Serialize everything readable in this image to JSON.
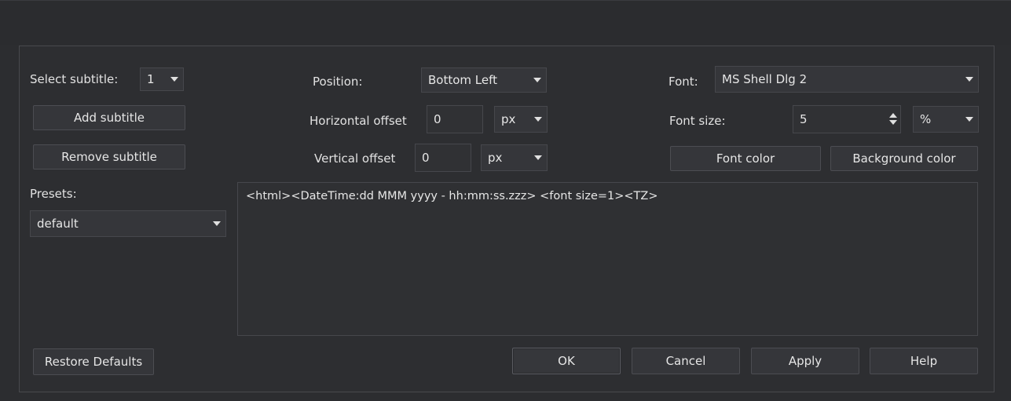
{
  "subtitle": {
    "select_label": "Select subtitle:",
    "selected": "1",
    "add_label": "Add subtitle",
    "remove_label": "Remove subtitle"
  },
  "presets": {
    "label": "Presets:",
    "selected": "default"
  },
  "position": {
    "position_label": "Position:",
    "position_value": "Bottom Left",
    "horizontal_label": "Horizontal offset",
    "horizontal_value": "0",
    "horizontal_unit": "px",
    "vertical_label": "Vertical offset",
    "vertical_value": "0",
    "vertical_unit": "px"
  },
  "font": {
    "font_label": "Font:",
    "font_value": "MS Shell Dlg 2",
    "size_label": "Font size:",
    "size_value": "5",
    "size_unit": "%",
    "color_label": "Font color",
    "background_label": "Background color"
  },
  "editor": {
    "text": "<html><DateTime:dd MMM yyyy - hh:mm:ss.zzz> <font size=1><TZ>"
  },
  "footer": {
    "restore_label": "Restore Defaults",
    "ok_label": "OK",
    "cancel_label": "Cancel",
    "apply_label": "Apply",
    "help_label": "Help"
  },
  "colors": {
    "background": "#2c2d30",
    "control": "#35363a",
    "border": "#46474c",
    "text": "#e6e6e6"
  }
}
